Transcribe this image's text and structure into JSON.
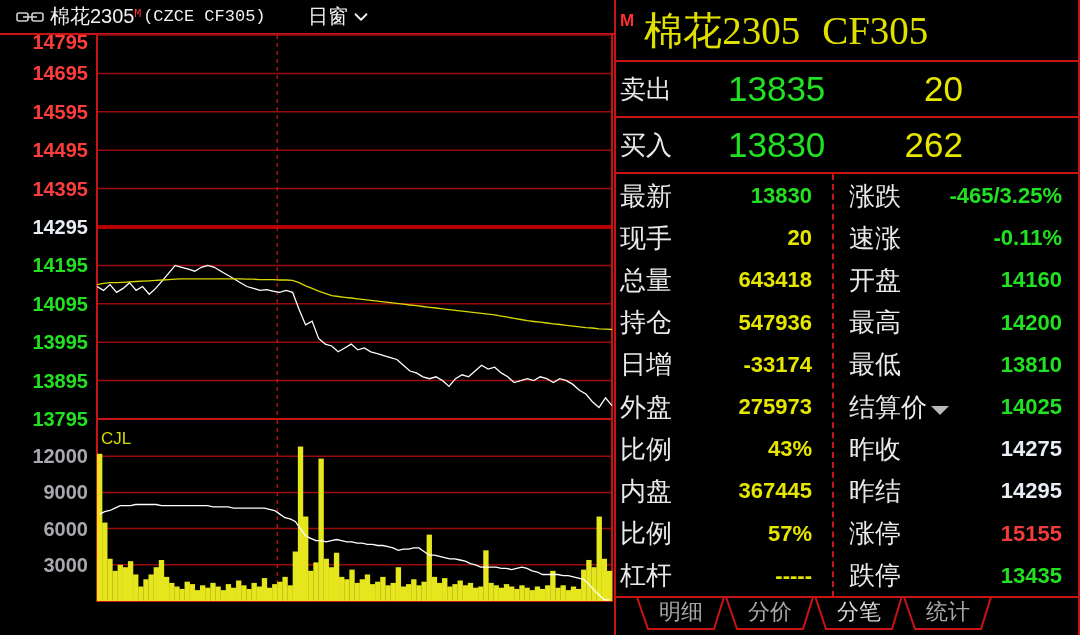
{
  "toolbar": {
    "symbol": "棉花2305",
    "badge": "M",
    "instrument": "(CZCE CF305)",
    "period": "日窗"
  },
  "price_chart": {
    "chart_data": {
      "type": "line",
      "grid": true,
      "ylim": [
        13795,
        14795
      ],
      "yticks": [
        14795,
        14695,
        14595,
        14495,
        14395,
        14295,
        14195,
        14095,
        13995,
        13895,
        13795
      ],
      "series": [
        {
          "color": "#ffffff",
          "values": [
            14140,
            14130,
            14145,
            14125,
            14135,
            14150,
            14130,
            14140,
            14120,
            14135,
            14155,
            14175,
            14195,
            14190,
            14185,
            14180,
            14190,
            14195,
            14190,
            14180,
            14170,
            14160,
            14150,
            14140,
            14135,
            14130,
            14132,
            14128,
            14125,
            14130,
            14125,
            14080,
            14040,
            14050,
            14005,
            13990,
            13985,
            13970,
            13980,
            13990,
            13975,
            13980,
            13970,
            13965,
            13960,
            13955,
            13950,
            13935,
            13920,
            13915,
            13905,
            13900,
            13905,
            13895,
            13880,
            13900,
            13910,
            13905,
            13920,
            13935,
            13925,
            13930,
            13915,
            13905,
            13890,
            13895,
            13900,
            13895,
            13905,
            13900,
            13890,
            13900,
            13895,
            13885,
            13870,
            13860,
            13840,
            13825,
            13850,
            13830
          ]
        },
        {
          "color": "#d8d800",
          "values": [
            14145,
            14148,
            14150,
            14150,
            14151,
            14152,
            14153,
            14154,
            14155,
            14156,
            14157,
            14158,
            14159,
            14160,
            14160,
            14160,
            14160,
            14160,
            14160,
            14160,
            14160,
            14160,
            14160,
            14159,
            14159,
            14158,
            14158,
            14158,
            14157,
            14157,
            14156,
            14150,
            14142,
            14135,
            14128,
            14122,
            14116,
            14114,
            14112,
            14110,
            14108,
            14106,
            14104,
            14102,
            14100,
            14098,
            14096,
            14094,
            14092,
            14090,
            14088,
            14086,
            14084,
            14082,
            14080,
            14078,
            14076,
            14074,
            14072,
            14070,
            14068,
            14066,
            14063,
            14060,
            14057,
            14054,
            14051,
            14049,
            14047,
            14045,
            14043,
            14041,
            14039,
            14037,
            14035,
            14033,
            14032,
            14030,
            14029,
            14028
          ]
        }
      ],
      "ref_lines": [
        {
          "axis": "y",
          "value": 14295
        }
      ]
    }
  },
  "volume_chart": {
    "chart_data": {
      "type": "bar",
      "title": "CJL",
      "grid": true,
      "ylim": [
        0,
        15000
      ],
      "yticks": [
        12000,
        9000,
        6000,
        3000
      ],
      "series": [
        {
          "type": "bar",
          "color": "#e6e61e",
          "values": [
            12200,
            6500,
            3500,
            2500,
            3000,
            2800,
            3300,
            2200,
            1200,
            1800,
            2200,
            2800,
            3400,
            2000,
            1500,
            1200,
            1000,
            1600,
            1400,
            900,
            1300,
            1100,
            1500,
            1200,
            900,
            1400,
            1100,
            1700,
            1300,
            1000,
            1500,
            1200,
            1900,
            1100,
            1400,
            1600,
            2000,
            1300,
            4100,
            12800,
            7000,
            2500,
            3200,
            11800,
            3500,
            2800,
            4000,
            2000,
            1800,
            2600,
            1500,
            1800,
            2200,
            1400,
            1600,
            2000,
            1300,
            1500,
            2800,
            1200,
            1400,
            1800,
            1300,
            1600,
            5500,
            2000,
            1500,
            1900,
            1200,
            1400,
            1700,
            1300,
            1500,
            1100,
            1200,
            4200,
            1500,
            1300,
            1100,
            1400,
            1200,
            1000,
            1300,
            1100,
            900,
            1200,
            1000,
            1300,
            2500,
            1100,
            1300,
            900,
            1200,
            1000,
            2600,
            3400,
            2800,
            7000,
            3500,
            2500
          ]
        },
        {
          "type": "line",
          "color": "#ffffff",
          "values": [
            7200,
            7400,
            7500,
            7700,
            7900,
            7900,
            7900,
            8000,
            8000,
            8000,
            8000,
            8000,
            7900,
            7900,
            7900,
            7900,
            7900,
            7900,
            7900,
            7900,
            7900,
            7900,
            7800,
            7800,
            7800,
            7800,
            7700,
            7700,
            7700,
            7700,
            7700,
            7700,
            7700,
            7600,
            7500,
            7200,
            6900,
            6800,
            6600,
            6000,
            5400,
            5200,
            5000,
            5000,
            4900,
            5000,
            5100,
            5000,
            4900,
            4900,
            4800,
            4800,
            4700,
            4700,
            4600,
            4600,
            4500,
            4400,
            4200,
            4300,
            4300,
            4400,
            4400,
            4100,
            3800,
            3800,
            3700,
            3600,
            3500,
            3500,
            3400,
            3300,
            3100,
            3000,
            2800,
            2800,
            2800,
            2800,
            2700,
            2700,
            2600,
            2700,
            2800,
            2700,
            2500,
            2400,
            2200,
            2200,
            2200,
            2200,
            2100,
            2100,
            2000,
            1900,
            1800,
            1400,
            900,
            500,
            100,
            100
          ]
        }
      ]
    }
  },
  "quote_panel": {
    "badge": "M",
    "name": "棉花2305",
    "code": "CF305",
    "order_book": [
      {
        "label": "卖出",
        "price": "13835",
        "volume": "20"
      },
      {
        "label": "买入",
        "price": "13830",
        "volume": "262"
      }
    ],
    "stats": {
      "left": [
        {
          "kind": "plain",
          "label": "最新",
          "value": "13830",
          "color": "#22e022"
        },
        {
          "kind": "plain",
          "label": "现手",
          "value": "20",
          "color": "#e6e600"
        },
        {
          "kind": "plain",
          "label": "总量",
          "value": "643418",
          "color": "#e6e600"
        },
        {
          "kind": "plain",
          "label": "持仓",
          "value": "547936",
          "color": "#e6e600"
        },
        {
          "kind": "plain",
          "label": "日增",
          "value": "-33174",
          "color": "#e6e600"
        },
        {
          "kind": "plain",
          "label": "外盘",
          "value": "275973",
          "color": "#e6e600"
        },
        {
          "kind": "plain",
          "label": "比例",
          "value": "43%",
          "color": "#e6e600"
        },
        {
          "kind": "plain",
          "label": "内盘",
          "value": "367445",
          "color": "#e6e600"
        },
        {
          "kind": "plain",
          "label": "比例",
          "value": "57%",
          "color": "#e6e600"
        },
        {
          "kind": "plain",
          "label": "杠杆",
          "value": "-----",
          "color": "#e6e600"
        }
      ],
      "right": [
        {
          "kind": "plain",
          "label": "涨跌",
          "value": "-465/3.25%",
          "color": "#22e022"
        },
        {
          "kind": "plain",
          "label": "速涨",
          "value": "-0.11%",
          "color": "#22e022"
        },
        {
          "kind": "plain",
          "label": "开盘",
          "value": "14160",
          "color": "#22e022"
        },
        {
          "kind": "plain",
          "label": "最高",
          "value": "14200",
          "color": "#22e022"
        },
        {
          "kind": "plain",
          "label": "最低",
          "value": "13810",
          "color": "#22e022"
        },
        {
          "kind": "dropdown",
          "label": "结算价",
          "value": "14025",
          "color": "#22e022"
        },
        {
          "kind": "plain",
          "label": "昨收",
          "value": "14275",
          "color": "#e8ecf4"
        },
        {
          "kind": "plain",
          "label": "昨结",
          "value": "14295",
          "color": "#e8ecf4"
        },
        {
          "kind": "plain",
          "label": "涨停",
          "value": "15155",
          "color": "#f03c3c"
        },
        {
          "kind": "plain",
          "label": "跌停",
          "value": "13435",
          "color": "#22e022"
        }
      ]
    }
  },
  "tabs": [
    {
      "label": "明细",
      "selected": false
    },
    {
      "label": "分价",
      "selected": false
    },
    {
      "label": "分笔",
      "selected": true
    },
    {
      "label": "统计",
      "selected": false
    }
  ]
}
